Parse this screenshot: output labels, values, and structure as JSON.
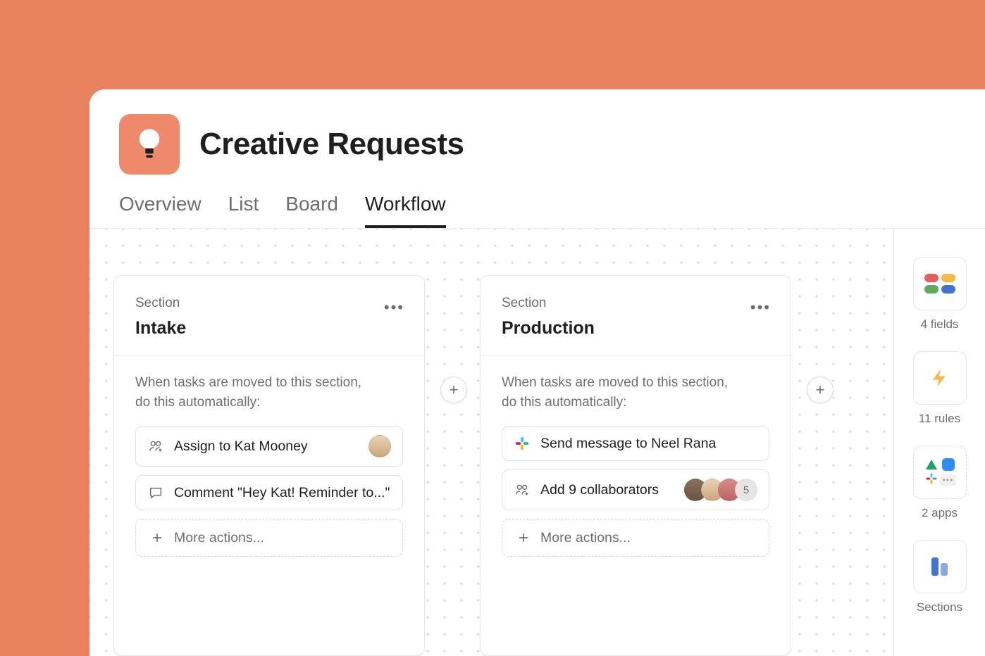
{
  "project": {
    "title": "Creative Requests"
  },
  "tabs": [
    {
      "label": "Overview"
    },
    {
      "label": "List"
    },
    {
      "label": "Board"
    },
    {
      "label": "Workflow"
    }
  ],
  "auto_prefix": "When tasks are moved to this section,",
  "auto_suffix": "do this automatically:",
  "more_actions_label": "More actions...",
  "sections": [
    {
      "label": "Section",
      "name": "Intake",
      "rules": [
        {
          "icon": "assign",
          "text": "Assign to Kat Mooney",
          "avatar": true
        },
        {
          "icon": "comment",
          "text": "Comment \"Hey Kat! Reminder to...\""
        }
      ]
    },
    {
      "label": "Section",
      "name": "Production",
      "rules": [
        {
          "icon": "slack",
          "text": "Send message to Neel Rana"
        },
        {
          "icon": "collab",
          "text": "Add 9 collaborators",
          "avatar_stack": 3,
          "avatar_more": "5"
        }
      ]
    }
  ],
  "rail": {
    "fields": "4 fields",
    "rules": "11 rules",
    "apps": "2 apps",
    "sections": "Sections"
  }
}
